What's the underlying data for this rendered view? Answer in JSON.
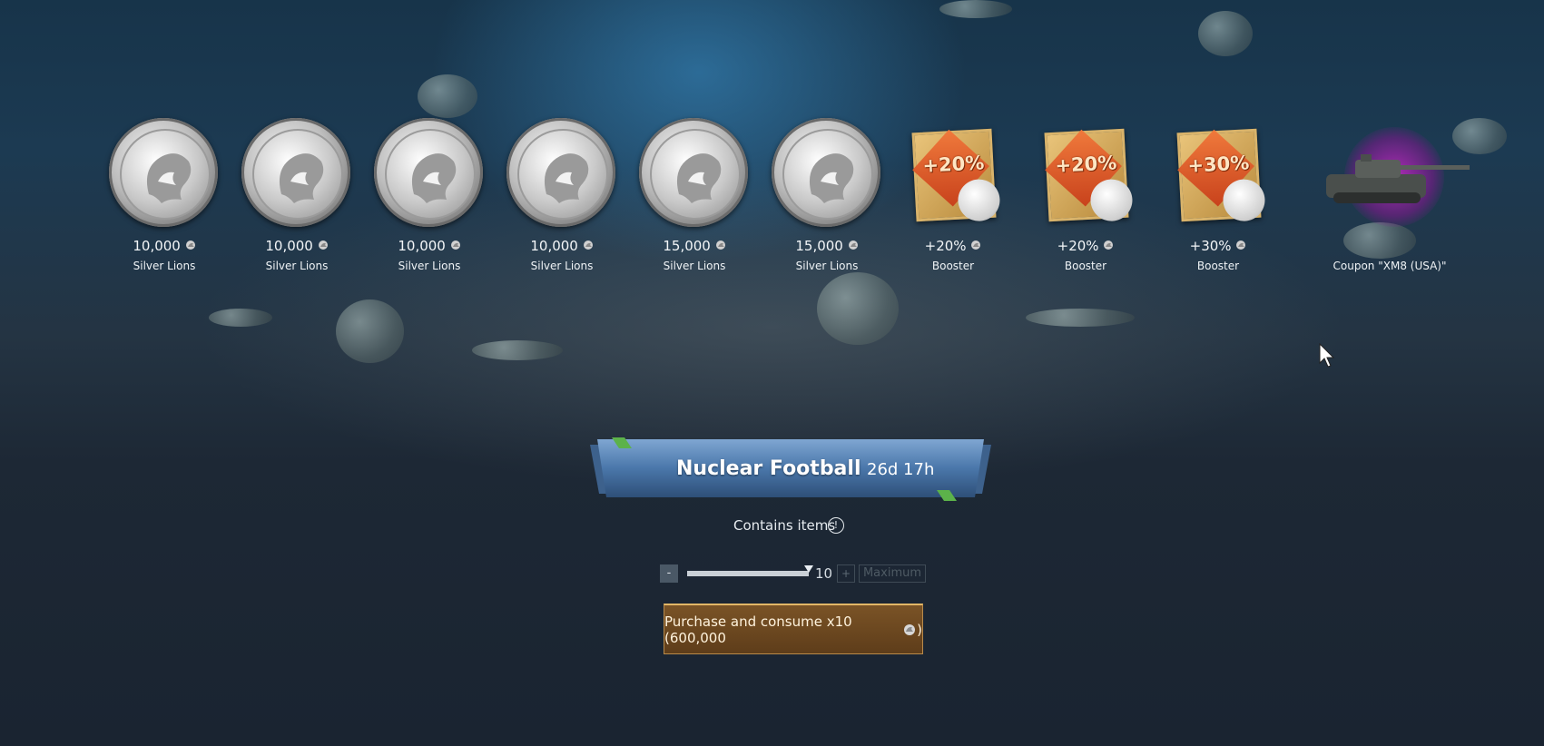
{
  "rewards": [
    {
      "type": "silver",
      "amount": "10,000",
      "name": "Silver Lions"
    },
    {
      "type": "silver",
      "amount": "10,000",
      "name": "Silver Lions"
    },
    {
      "type": "silver",
      "amount": "10,000",
      "name": "Silver Lions"
    },
    {
      "type": "silver",
      "amount": "10,000",
      "name": "Silver Lions"
    },
    {
      "type": "silver",
      "amount": "15,000",
      "name": "Silver Lions"
    },
    {
      "type": "silver",
      "amount": "15,000",
      "name": "Silver Lions"
    },
    {
      "type": "booster",
      "amount": "+20%",
      "name": "Booster",
      "card_label": "+20%"
    },
    {
      "type": "booster",
      "amount": "+20%",
      "name": "Booster",
      "card_label": "+20%"
    },
    {
      "type": "booster",
      "amount": "+30%",
      "name": "Booster",
      "card_label": "+30%"
    },
    {
      "type": "coupon",
      "amount": "",
      "name": "Coupon \"XM8 (USA)\""
    }
  ],
  "trophy": {
    "title": "Nuclear Football",
    "timer": "26d 17h",
    "contains_label": "Contains items",
    "info_icon": "!"
  },
  "quantity": {
    "minus_label": "-",
    "value": "10",
    "plus_label": "+",
    "max_label": "Maximum",
    "slider_fraction": 1.0
  },
  "purchase": {
    "label": "Purchase and consume x10 (600,000",
    "suffix": ")",
    "currency_icon": "silver-lion-icon"
  },
  "colors": {
    "accent_gold": "#e2b767",
    "purchase_bg": "#6b4820",
    "banner_blue": "#4a77aa",
    "coupon_glow": "#c828c8"
  }
}
